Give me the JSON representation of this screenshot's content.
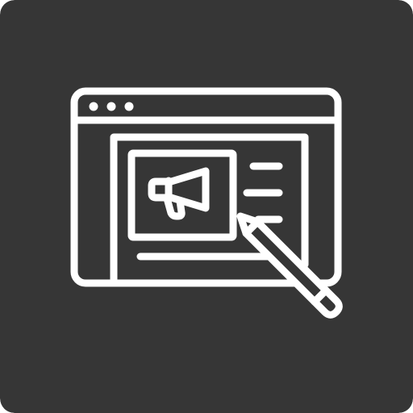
{
  "icon": {
    "name": "web-marketing-editor-icon",
    "background_color": "#363636",
    "stroke_color": "#ffffff"
  }
}
